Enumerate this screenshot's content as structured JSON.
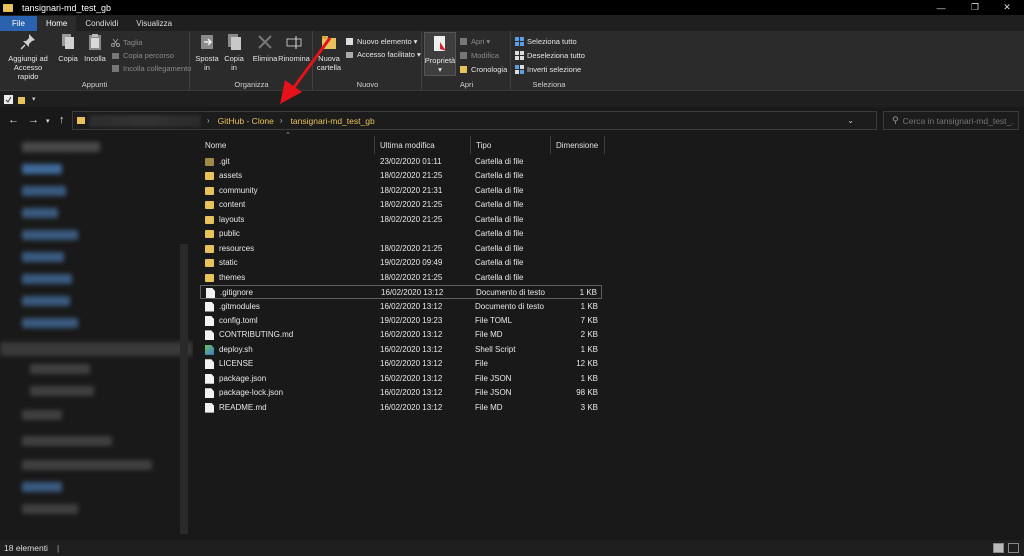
{
  "window": {
    "title": "tansignari-md_test_gb",
    "controls": [
      "—",
      "❐",
      "✕"
    ]
  },
  "tabs": [
    {
      "label": "File"
    },
    {
      "label": "Home"
    },
    {
      "label": "Condividi"
    },
    {
      "label": "Visualizza"
    }
  ],
  "ribbon": {
    "appunti": {
      "label": "Appunti",
      "pin_line1": "Aggiungi ad",
      "pin_line2": "Accesso rapido",
      "copy": "Copia",
      "paste": "Incolla",
      "cut": "Taglia",
      "copy_path": "Copia percorso",
      "paste_link": "Incolla collegamento"
    },
    "organizza": {
      "label": "Organizza",
      "move_line1": "Sposta",
      "move_line2": "in",
      "copyto_line1": "Copia",
      "copyto_line2": "in",
      "delete": "Elimina",
      "rename": "Rinomina"
    },
    "nuovo": {
      "label": "Nuovo",
      "newfolder_line1": "Nuova",
      "newfolder_line2": "cartella",
      "new_item": "Nuovo elemento",
      "easy_access": "Accesso facilitato"
    },
    "apri": {
      "label": "Apri",
      "properties": "Proprietà",
      "open": "Apri",
      "edit": "Modifica",
      "history": "Cronologia"
    },
    "seleziona": {
      "label": "Seleziona",
      "select_all": "Seleziona tutto",
      "select_none": "Deseleziona tutto",
      "invert": "Inverti selezione"
    }
  },
  "address": {
    "crumbs": [
      "GitHub - Clone",
      "tansignari-md_test_gb"
    ]
  },
  "search": {
    "placeholder": "Cerca in tansignari-md_test_..."
  },
  "columns": {
    "name": "Nome",
    "modified": "Ultima modifica",
    "type": "Tipo",
    "size": "Dimensione"
  },
  "files": [
    {
      "name": ".git",
      "modified": "23/02/2020 01:11",
      "type": "Cartella di file",
      "size": "",
      "icon": "folder-icon"
    },
    {
      "name": "assets",
      "modified": "18/02/2020 21:25",
      "type": "Cartella di file",
      "size": "",
      "icon": "folder-icon"
    },
    {
      "name": "community",
      "modified": "18/02/2020 21:31",
      "type": "Cartella di file",
      "size": "",
      "icon": "folder-icon"
    },
    {
      "name": "content",
      "modified": "18/02/2020 21:25",
      "type": "Cartella di file",
      "size": "",
      "icon": "folder-icon"
    },
    {
      "name": "layouts",
      "modified": "18/02/2020 21:25",
      "type": "Cartella di file",
      "size": "",
      "icon": "folder-icon"
    },
    {
      "name": "public",
      "modified": "",
      "type": "Cartella di file",
      "size": "",
      "icon": "folder-icon"
    },
    {
      "name": "resources",
      "modified": "18/02/2020 21:25",
      "type": "Cartella di file",
      "size": "",
      "icon": "folder-icon"
    },
    {
      "name": "static",
      "modified": "19/02/2020 09:49",
      "type": "Cartella di file",
      "size": "",
      "icon": "folder-icon"
    },
    {
      "name": "themes",
      "modified": "18/02/2020 21:25",
      "type": "Cartella di file",
      "size": "",
      "icon": "folder-icon"
    },
    {
      "name": ".gitignore",
      "modified": "16/02/2020 13:12",
      "type": "Documento di testo",
      "size": "1 KB",
      "icon": "document-icon"
    },
    {
      "name": ".gitmodules",
      "modified": "16/02/2020 13:12",
      "type": "Documento di testo",
      "size": "1 KB",
      "icon": "document-icon"
    },
    {
      "name": "config.toml",
      "modified": "19/02/2020 19:23",
      "type": "File TOML",
      "size": "7 KB",
      "icon": "document-icon"
    },
    {
      "name": "CONTRIBUTING.md",
      "modified": "16/02/2020 13:12",
      "type": "File MD",
      "size": "2 KB",
      "icon": "document-icon"
    },
    {
      "name": "deploy.sh",
      "modified": "16/02/2020 13:12",
      "type": "Shell Script",
      "size": "1 KB",
      "icon": "shell-script-icon"
    },
    {
      "name": "LICENSE",
      "modified": "16/02/2020 13:12",
      "type": "File",
      "size": "12 KB",
      "icon": "document-icon"
    },
    {
      "name": "package.json",
      "modified": "16/02/2020 13:12",
      "type": "File JSON",
      "size": "1 KB",
      "icon": "document-icon"
    },
    {
      "name": "package-lock.json",
      "modified": "16/02/2020 13:12",
      "type": "File JSON",
      "size": "98 KB",
      "icon": "document-icon"
    },
    {
      "name": "README.md",
      "modified": "16/02/2020 13:12",
      "type": "File MD",
      "size": "3 KB",
      "icon": "document-icon"
    }
  ],
  "status": {
    "count": "18 elementi",
    "separator": "|"
  },
  "colors": {
    "accent": "#2a62b0",
    "folder": "#e8c25a",
    "arrow": "#e3121b",
    "background": "#191919"
  }
}
